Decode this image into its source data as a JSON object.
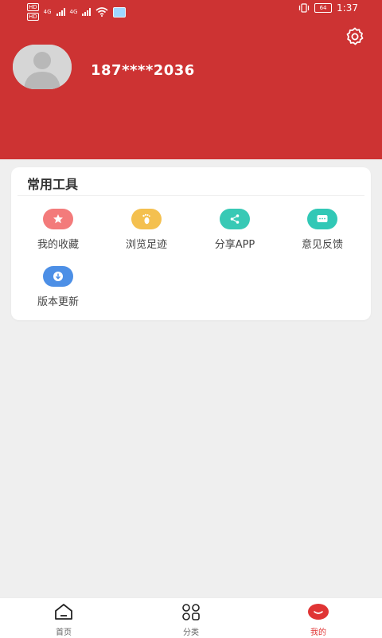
{
  "status_bar": {
    "hd1": "HD",
    "hd2": "HD",
    "net1": "4G",
    "net2": "4G",
    "battery": "64",
    "time": "1:37"
  },
  "header": {
    "phone": "187****2036"
  },
  "tools": {
    "title": "常用工具",
    "items": [
      {
        "label": "我的收藏",
        "icon": "star-icon",
        "color": "#f37b7b"
      },
      {
        "label": "浏览足迹",
        "icon": "footprint-icon",
        "color": "#f4c04f"
      },
      {
        "label": "分享APP",
        "icon": "share-icon",
        "color": "#38c9b5"
      },
      {
        "label": "意见反馈",
        "icon": "feedback-icon",
        "color": "#31c8b6"
      },
      {
        "label": "版本更新",
        "icon": "download-icon",
        "color": "#4c8fe6"
      }
    ]
  },
  "tabbar": {
    "tabs": [
      {
        "label": "首页",
        "icon": "home-icon"
      },
      {
        "label": "分类",
        "icon": "category-icon"
      },
      {
        "label": "我的",
        "icon": "profile-icon",
        "active": true
      }
    ],
    "active_color": "#e03434"
  },
  "colors": {
    "header_bg": "#cd3333",
    "page_bg": "#efefef"
  }
}
